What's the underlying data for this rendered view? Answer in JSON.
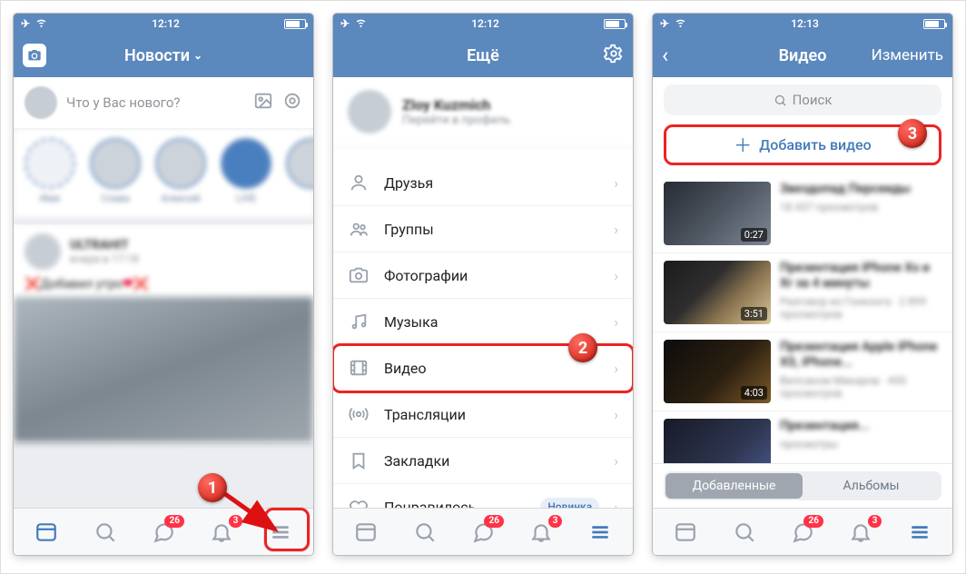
{
  "phone1": {
    "status": {
      "time": "12:12"
    },
    "nav": {
      "title": "Новости"
    },
    "compose": {
      "placeholder": "Что у Вас нового?"
    },
    "stories": [
      "Имя",
      "Слава",
      "Алексей",
      "LIVE",
      " "
    ],
    "post": {
      "author": "ULTRAHIT",
      "date": "вчера в 17:18",
      "text": "Добавил утро"
    },
    "tabs": {
      "messages_badge": "26",
      "notifs_badge": "3"
    }
  },
  "phone2": {
    "status": {
      "time": "12:12"
    },
    "nav": {
      "title": "Ещё"
    },
    "profile": {
      "name": "Zloy Kuzmich",
      "sub": "Перейти в профиль"
    },
    "menu": [
      {
        "id": "friends",
        "label": "Друзья",
        "icon": "user"
      },
      {
        "id": "groups",
        "label": "Группы",
        "icon": "users"
      },
      {
        "id": "photos",
        "label": "Фотографии",
        "icon": "camera"
      },
      {
        "id": "music",
        "label": "Музыка",
        "icon": "music"
      },
      {
        "id": "video",
        "label": "Видео",
        "icon": "film",
        "highlight": true
      },
      {
        "id": "live",
        "label": "Трансляции",
        "icon": "broadcast"
      },
      {
        "id": "bookmarks",
        "label": "Закладки",
        "icon": "bookmark"
      },
      {
        "id": "liked",
        "label": "Понравилось",
        "icon": "heart",
        "pill": "Новинка"
      }
    ],
    "tabs": {
      "messages_badge": "26",
      "notifs_badge": "3"
    }
  },
  "phone3": {
    "status": {
      "time": "12:13"
    },
    "nav": {
      "title": "Видео",
      "right": "Изменить"
    },
    "search": {
      "placeholder": "Поиск"
    },
    "add_label": "Добавить видео",
    "videos": [
      {
        "title": "Звездопад Персеиды",
        "sub": "18 437 просмотров",
        "dur": "0:27",
        "thumb": "a"
      },
      {
        "title": "Презентация iPhone Xs и Xr за 4 минуты",
        "sub": "Разговор из Гонконга · 2 899 просмотров",
        "dur": "3:51",
        "thumb": "b"
      },
      {
        "title": "Презентация Apple iPhone XS, iPhone...",
        "sub": "Вилсаком Макаров · 450 просмотров",
        "dur": "4:03",
        "thumb": "c"
      },
      {
        "title": "Презентация...",
        "sub": "просмотры",
        "dur": "",
        "thumb": "d"
      }
    ],
    "segments": {
      "left": "Добавленные",
      "right": "Альбомы"
    },
    "tabs": {
      "messages_badge": "26",
      "notifs_badge": "3"
    }
  },
  "steps": {
    "s1": "1",
    "s2": "2",
    "s3": "3"
  }
}
